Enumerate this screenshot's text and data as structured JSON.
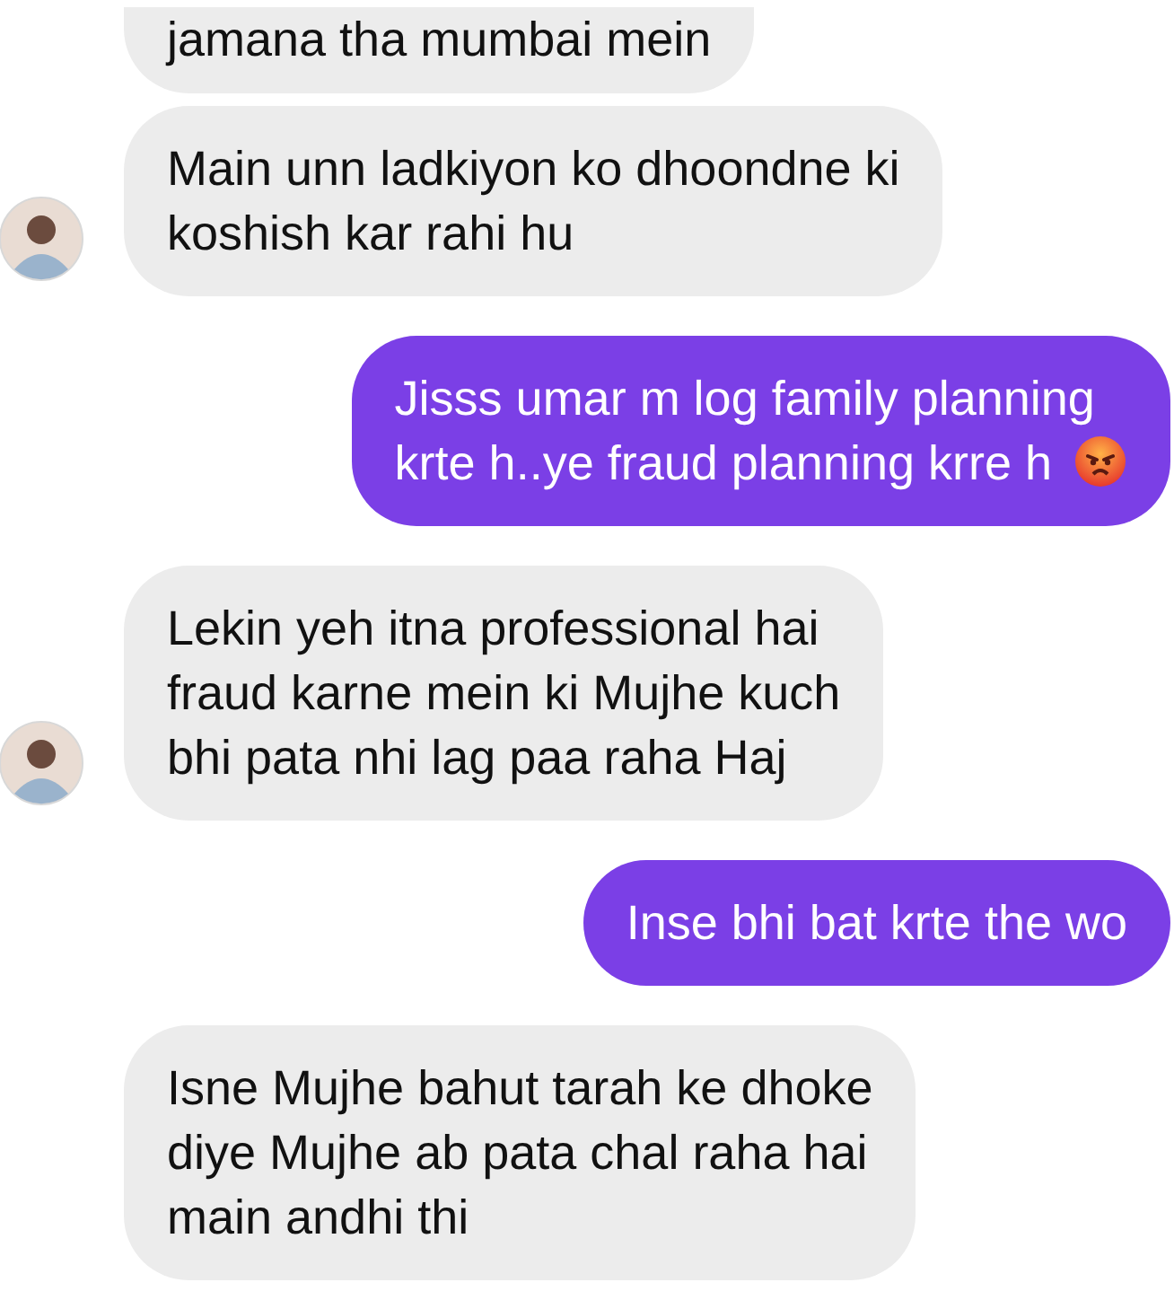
{
  "messages": [
    {
      "kind": "received",
      "text": "jamana tha mumbai mein",
      "avatar": false,
      "emoji": false
    },
    {
      "kind": "received",
      "text": "Main unn ladkiyon ko dhoondne ki\nkoshish kar rahi hu",
      "avatar": true,
      "emoji": false
    },
    {
      "kind": "sent",
      "text": "Jisss umar m log family planning\nkrte h..ye fraud planning krre h",
      "emoji": true
    },
    {
      "kind": "received",
      "text": "Lekin yeh itna professional hai\nfraud karne mein ki Mujhe kuch\nbhi pata nhi lag paa raha Haj",
      "avatar": true,
      "emoji": false
    },
    {
      "kind": "sent",
      "text": "Inse bhi bat krte the wo",
      "emoji": false
    },
    {
      "kind": "received",
      "text": "Isne Mujhe bahut tarah ke dhoke\ndiye Mujhe ab pata chal raha hai\nmain andhi thi",
      "avatar": false,
      "emoji": false
    }
  ]
}
